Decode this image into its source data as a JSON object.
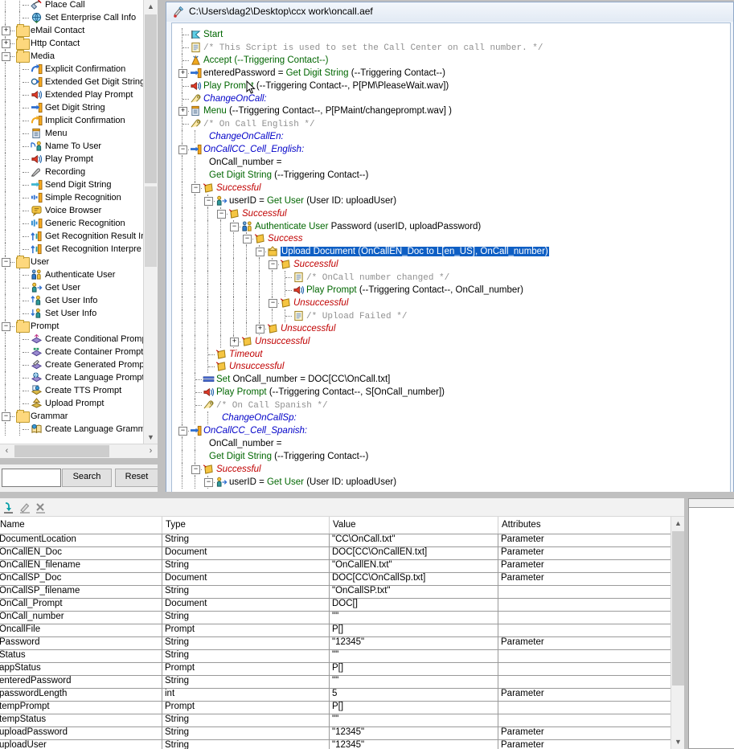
{
  "palette": {
    "scroll_v_position": "middle",
    "items": [
      {
        "label": "Place Call",
        "indent": 2,
        "icon": "place-call-icon",
        "type": "leaf"
      },
      {
        "label": "Set Enterprise Call Info",
        "indent": 2,
        "icon": "set-enterprise-call-info-icon",
        "type": "leaf"
      },
      {
        "label": "eMail Contact",
        "indent": 1,
        "icon": "folder-icon",
        "type": "folder",
        "expander": "+"
      },
      {
        "label": "Http Contact",
        "indent": 1,
        "icon": "folder-icon",
        "type": "folder",
        "expander": "+"
      },
      {
        "label": "Media",
        "indent": 1,
        "icon": "folder-icon",
        "type": "folder",
        "expander": "-"
      },
      {
        "label": "Explicit Confirmation",
        "indent": 2,
        "icon": "explicit-confirmation-icon",
        "type": "leaf"
      },
      {
        "label": "Extended Get Digit String",
        "indent": 2,
        "icon": "extended-get-digit-string-icon",
        "type": "leaf"
      },
      {
        "label": "Extended Play Prompt",
        "indent": 2,
        "icon": "extended-play-prompt-icon",
        "type": "leaf"
      },
      {
        "label": "Get Digit String",
        "indent": 2,
        "icon": "get-digit-string-icon",
        "type": "leaf"
      },
      {
        "label": "Implicit Confirmation",
        "indent": 2,
        "icon": "implicit-confirmation-icon",
        "type": "leaf"
      },
      {
        "label": "Menu",
        "indent": 2,
        "icon": "menu-icon",
        "type": "leaf"
      },
      {
        "label": "Name To User",
        "indent": 2,
        "icon": "name-to-user-icon",
        "type": "leaf"
      },
      {
        "label": "Play Prompt",
        "indent": 2,
        "icon": "play-prompt-icon",
        "type": "leaf"
      },
      {
        "label": "Recording",
        "indent": 2,
        "icon": "recording-icon",
        "type": "leaf"
      },
      {
        "label": "Send Digit String",
        "indent": 2,
        "icon": "send-digit-string-icon",
        "type": "leaf"
      },
      {
        "label": "Simple Recognition",
        "indent": 2,
        "icon": "simple-recognition-icon",
        "type": "leaf"
      },
      {
        "label": "Voice Browser",
        "indent": 2,
        "icon": "voice-browser-icon",
        "type": "leaf"
      },
      {
        "label": "Generic Recognition",
        "indent": 2,
        "icon": "generic-recognition-icon",
        "type": "leaf"
      },
      {
        "label": "Get Recognition Result In",
        "indent": 2,
        "icon": "get-recognition-result-icon",
        "type": "leaf"
      },
      {
        "label": "Get Recognition Interpre",
        "indent": 2,
        "icon": "get-recognition-interpretation-icon",
        "type": "leaf"
      },
      {
        "label": "User",
        "indent": 1,
        "icon": "folder-icon",
        "type": "folder",
        "expander": "-"
      },
      {
        "label": "Authenticate User",
        "indent": 2,
        "icon": "authenticate-user-icon",
        "type": "leaf"
      },
      {
        "label": "Get User",
        "indent": 2,
        "icon": "get-user-icon",
        "type": "leaf"
      },
      {
        "label": "Get User Info",
        "indent": 2,
        "icon": "get-user-info-icon",
        "type": "leaf"
      },
      {
        "label": "Set User Info",
        "indent": 2,
        "icon": "set-user-info-icon",
        "type": "leaf"
      },
      {
        "label": "Prompt",
        "indent": 1,
        "icon": "folder-icon",
        "type": "folder",
        "expander": "-"
      },
      {
        "label": "Create Conditional Promp",
        "indent": 2,
        "icon": "create-conditional-prompt-icon",
        "type": "leaf"
      },
      {
        "label": "Create Container Prompt",
        "indent": 2,
        "icon": "create-container-prompt-icon",
        "type": "leaf"
      },
      {
        "label": "Create Generated Promp",
        "indent": 2,
        "icon": "create-generated-prompt-icon",
        "type": "leaf"
      },
      {
        "label": "Create Language Prompt",
        "indent": 2,
        "icon": "create-language-prompt-icon",
        "type": "leaf"
      },
      {
        "label": "Create TTS Prompt",
        "indent": 2,
        "icon": "create-tts-prompt-icon",
        "type": "leaf"
      },
      {
        "label": "Upload Prompt",
        "indent": 2,
        "icon": "upload-prompt-icon",
        "type": "leaf"
      },
      {
        "label": "Grammar",
        "indent": 1,
        "icon": "folder-icon",
        "type": "folder",
        "expander": "-"
      },
      {
        "label": "Create Language Gramm",
        "indent": 2,
        "icon": "create-language-grammar-icon",
        "type": "leaf"
      }
    ]
  },
  "search": {
    "input_value": "",
    "search_label": "Search",
    "reset_label": "Reset"
  },
  "editor": {
    "title": "C:\\Users\\dag2\\Desktop\\ccx work\\oncall.aef",
    "title_icon": "script-file-icon",
    "rows": [
      {
        "indent": 1,
        "icon": "start-flag-icon",
        "expander": "",
        "style": "t-green",
        "text": "Start"
      },
      {
        "indent": 1,
        "icon": "annotate-icon",
        "expander": "",
        "style": "t-comment",
        "text": "/* This Script is used to set the Call Center on call number. */"
      },
      {
        "indent": 1,
        "icon": "accept-icon",
        "expander": "",
        "style": "t-green",
        "text": "Accept (--Triggering Contact--)",
        "prefix": "",
        "suffix": ""
      },
      {
        "indent": 1,
        "icon": "get-digit-string-icon",
        "expander": "+",
        "style": "mixed",
        "text": "enteredPassword = Get Digit String (--Triggering Contact--)",
        "segments": [
          {
            "t": "enteredPassword = ",
            "c": "t-black"
          },
          {
            "t": "Get Digit String",
            "c": "t-green"
          },
          {
            "t": " (--Triggering Contact--)",
            "c": "t-black"
          }
        ]
      },
      {
        "indent": 1,
        "icon": "play-prompt-icon",
        "expander": "",
        "style": "mixed",
        "text": "Play Prompt (--Triggering Contact--, P[PM\\PleaseWait.wav])",
        "segments": [
          {
            "t": "Play Prompt",
            "c": "t-green"
          },
          {
            "t": " (--Triggering Contact--, P[PM\\PleaseWait.wav])",
            "c": "t-black"
          }
        ]
      },
      {
        "indent": 1,
        "icon": "label-icon",
        "expander": "",
        "style": "t-blue",
        "text": "ChangeOnCall:"
      },
      {
        "indent": 1,
        "icon": "menu-icon",
        "expander": "+",
        "style": "mixed",
        "text": "Menu (--Triggering Contact--, P[PMaint/changeprompt.wav] )",
        "segments": [
          {
            "t": "Menu",
            "c": "t-green"
          },
          {
            "t": " (--Triggering Contact--, P[PMaint/changeprompt.wav] )",
            "c": "t-black"
          }
        ]
      },
      {
        "indent": 1,
        "icon": "label-icon",
        "expander": "",
        "style": "t-comment",
        "text": "/* On Call English */"
      },
      {
        "indent": 2,
        "icon": "",
        "expander": "",
        "style": "t-blue",
        "text": "ChangeOnCallEn:"
      },
      {
        "indent": 1,
        "icon": "get-digit-string-icon",
        "expander": "-",
        "style": "t-blue",
        "text": "OnCallCC_Cell_English:"
      },
      {
        "indent": 2,
        "icon": "",
        "expander": "",
        "style": "t-black",
        "text": "OnCall_number ="
      },
      {
        "indent": 2,
        "icon": "",
        "expander": "",
        "style": "t-green",
        "text": "Get Digit String (--Triggering Contact--)",
        "segments": [
          {
            "t": "Get Digit String",
            "c": "t-green"
          },
          {
            "t": " (--Triggering Contact--)",
            "c": "t-black"
          }
        ]
      },
      {
        "indent": 2,
        "icon": "branch-icon",
        "expander": "-",
        "style": "t-red",
        "text": "Successful"
      },
      {
        "indent": 3,
        "icon": "get-user-icon",
        "expander": "-",
        "style": "mixed",
        "text": "userID = Get User (User ID: uploadUser)",
        "segments": [
          {
            "t": "userID = ",
            "c": "t-black"
          },
          {
            "t": "Get User",
            "c": "t-green"
          },
          {
            "t": " (User ID: uploadUser)",
            "c": "t-black"
          }
        ]
      },
      {
        "indent": 4,
        "icon": "branch-icon",
        "expander": "-",
        "style": "t-red",
        "text": "Successful"
      },
      {
        "indent": 5,
        "icon": "authenticate-user-icon",
        "expander": "-",
        "style": "mixed",
        "text": "Authenticate User Password (userID, uploadPassword)",
        "segments": [
          {
            "t": "Authenticate User",
            "c": "t-green"
          },
          {
            "t": " Password (userID, uploadPassword)",
            "c": "t-black"
          }
        ]
      },
      {
        "indent": 6,
        "icon": "branch-icon",
        "expander": "-",
        "style": "t-red",
        "text": "Success"
      },
      {
        "indent": 7,
        "icon": "upload-document-icon",
        "expander": "-",
        "style": "selected",
        "text": "Upload Document (OnCallEN_Doc to L[en_US], OnCall_number)",
        "selected": true
      },
      {
        "indent": 8,
        "icon": "branch-icon",
        "expander": "-",
        "style": "t-red",
        "text": "Successful"
      },
      {
        "indent": 9,
        "icon": "annotate-icon",
        "expander": "",
        "style": "t-comment",
        "text": "/* OnCall number changed */"
      },
      {
        "indent": 9,
        "icon": "play-prompt-icon",
        "expander": "",
        "style": "mixed",
        "text": "Play Prompt (--Triggering Contact--, OnCall_number)",
        "segments": [
          {
            "t": "Play Prompt",
            "c": "t-green"
          },
          {
            "t": " (--Triggering Contact--, OnCall_number)",
            "c": "t-black"
          }
        ]
      },
      {
        "indent": 8,
        "icon": "branch-icon",
        "expander": "-",
        "style": "t-red",
        "text": "Unsuccessful"
      },
      {
        "indent": 9,
        "icon": "annotate-icon",
        "expander": "",
        "style": "t-comment",
        "text": "/* Upload Failed */"
      },
      {
        "indent": 7,
        "icon": "branch-icon",
        "expander": "+",
        "style": "t-red",
        "text": "Unsuccessful"
      },
      {
        "indent": 5,
        "icon": "branch-icon",
        "expander": "+",
        "style": "t-red",
        "text": "Unsuccessful"
      },
      {
        "indent": 3,
        "icon": "branch-icon",
        "expander": "",
        "style": "t-red",
        "text": "Timeout"
      },
      {
        "indent": 3,
        "icon": "branch-icon",
        "expander": "",
        "style": "t-red",
        "text": "Unsuccessful"
      },
      {
        "indent": 2,
        "icon": "set-icon",
        "expander": "",
        "style": "mixed",
        "text": "Set OnCall_number = DOC[CC\\OnCall.txt]",
        "segments": [
          {
            "t": "Set",
            "c": "t-green"
          },
          {
            "t": " OnCall_number = DOC[CC\\OnCall.txt]",
            "c": "t-black"
          }
        ]
      },
      {
        "indent": 2,
        "icon": "play-prompt-icon",
        "expander": "",
        "style": "mixed",
        "text": "Play Prompt (--Triggering Contact--, S[OnCall_number])",
        "segments": [
          {
            "t": "Play Prompt",
            "c": "t-green"
          },
          {
            "t": " (--Triggering Contact--, S[OnCall_number])",
            "c": "t-black"
          }
        ]
      },
      {
        "indent": 2,
        "icon": "label-icon",
        "expander": "",
        "style": "t-comment",
        "text": "/* On Call Spanish */"
      },
      {
        "indent": 3,
        "icon": "",
        "expander": "",
        "style": "t-blue",
        "text": "ChangeOnCallSp:"
      },
      {
        "indent": 1,
        "icon": "get-digit-string-icon",
        "expander": "-",
        "style": "t-blue",
        "text": "OnCallCC_Cell_Spanish:"
      },
      {
        "indent": 2,
        "icon": "",
        "expander": "",
        "style": "t-black",
        "text": "OnCall_number ="
      },
      {
        "indent": 2,
        "icon": "",
        "expander": "",
        "style": "mixed",
        "text": "Get Digit String (--Triggering Contact--)",
        "segments": [
          {
            "t": "Get Digit String",
            "c": "t-green"
          },
          {
            "t": " (--Triggering Contact--)",
            "c": "t-black"
          }
        ]
      },
      {
        "indent": 2,
        "icon": "branch-icon",
        "expander": "-",
        "style": "t-red",
        "text": "Successful"
      },
      {
        "indent": 3,
        "icon": "get-user-icon",
        "expander": "-",
        "style": "mixed",
        "text": "userID = Get User (User ID: uploadUser)",
        "segments": [
          {
            "t": "userID = ",
            "c": "t-black"
          },
          {
            "t": "Get User",
            "c": "t-green"
          },
          {
            "t": " (User ID: uploadUser)",
            "c": "t-black"
          }
        ]
      }
    ]
  },
  "variables_panel": {
    "toolbar_icons": [
      "insert-variable-icon",
      "edit-variable-icon",
      "delete-variable-icon"
    ],
    "columns": [
      "Name",
      "Type",
      "Value",
      "Attributes"
    ],
    "rows": [
      {
        "name": "DocumentLocation",
        "type": "String",
        "value": "\"CC\\OnCall.txt\"",
        "attributes": "Parameter"
      },
      {
        "name": "OnCallEN_Doc",
        "type": "Document",
        "value": "DOC[CC\\OnCallEN.txt]",
        "attributes": "Parameter"
      },
      {
        "name": "OnCallEN_filename",
        "type": "String",
        "value": "\"OnCallEN.txt\"",
        "attributes": "Parameter"
      },
      {
        "name": "OnCallSP_Doc",
        "type": "Document",
        "value": "DOC[CC\\OnCallSp.txt]",
        "attributes": "Parameter"
      },
      {
        "name": "OnCallSP_filename",
        "type": "String",
        "value": "\"OnCallSP.txt\"",
        "attributes": ""
      },
      {
        "name": "OnCall_Prompt",
        "type": "Document",
        "value": "DOC[]",
        "attributes": ""
      },
      {
        "name": "OnCall_number",
        "type": "String",
        "value": "\"\"",
        "attributes": ""
      },
      {
        "name": "OncallFile",
        "type": "Prompt",
        "value": "P[]",
        "attributes": ""
      },
      {
        "name": "Password",
        "type": "String",
        "value": "\"12345\"",
        "attributes": "Parameter"
      },
      {
        "name": "Status",
        "type": "String",
        "value": "\"\"",
        "attributes": ""
      },
      {
        "name": "appStatus",
        "type": "Prompt",
        "value": "P[]",
        "attributes": ""
      },
      {
        "name": "enteredPassword",
        "type": "String",
        "value": "\"\"",
        "attributes": ""
      },
      {
        "name": "passwordLength",
        "type": "int",
        "value": "5",
        "attributes": "Parameter"
      },
      {
        "name": "tempPrompt",
        "type": "Prompt",
        "value": "P[]",
        "attributes": ""
      },
      {
        "name": "tempStatus",
        "type": "String",
        "value": "\"\"",
        "attributes": ""
      },
      {
        "name": "uploadPassword",
        "type": "String",
        "value": "\"12345\"",
        "attributes": "Parameter"
      },
      {
        "name": "uploadUser",
        "type": "String",
        "value": "\"12345\"",
        "attributes": "Parameter"
      }
    ]
  },
  "colors": {
    "selection_blue": "#0f5fc4",
    "keyword_green": "#006600",
    "label_blue": "#0000c8",
    "branch_red": "#c00000",
    "comment_gray": "#909090",
    "window_chrome": "#c0c0c0"
  }
}
